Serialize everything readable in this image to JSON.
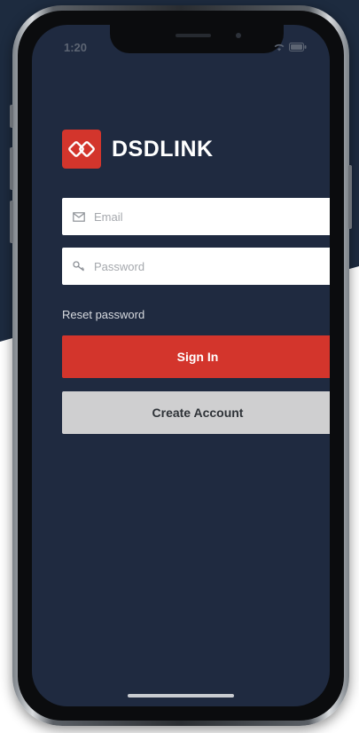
{
  "status_bar": {
    "time": "1:20"
  },
  "brand": {
    "name": "DSDLINK",
    "logo_icon": "interlinked-rings-icon",
    "color": "#d3352c"
  },
  "login_form": {
    "email_placeholder": "Email",
    "email_value": "",
    "email_icon": "envelope-icon",
    "password_placeholder": "Password",
    "password_value": "",
    "password_icon": "key-icon",
    "reset_label": "Reset password",
    "signin_label": "Sign In",
    "create_label": "Create Account"
  },
  "colors": {
    "screen_bg": "#1f2a40",
    "backdrop_dark": "#1d2b3f",
    "primary": "#d3352c",
    "secondary": "#cfcfd0"
  }
}
